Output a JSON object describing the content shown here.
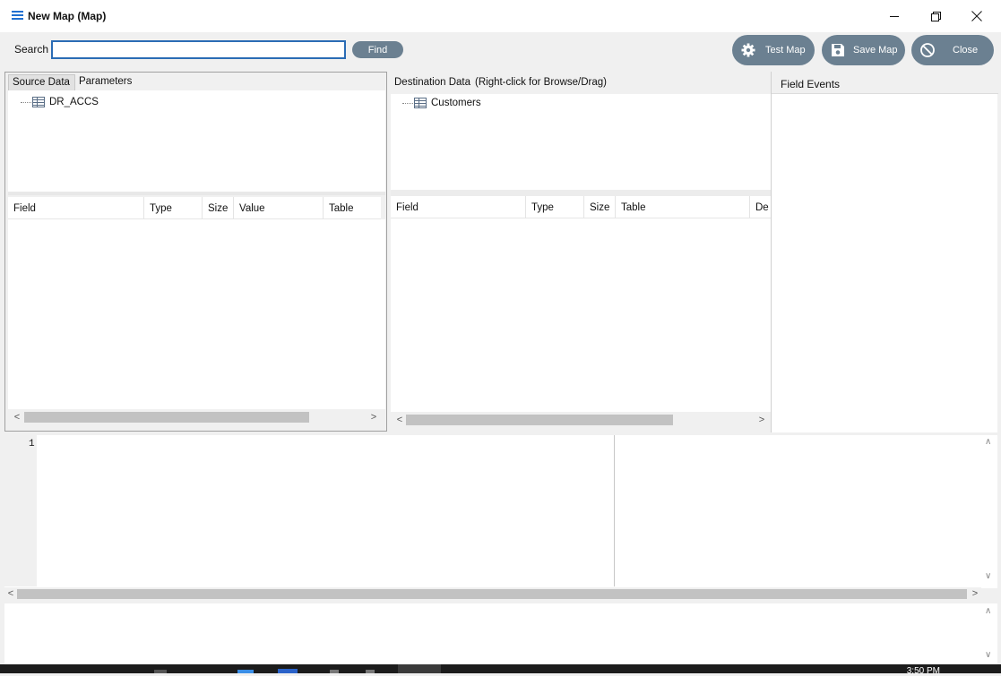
{
  "window": {
    "title": "New Map (Map)",
    "minimize_icon": "minimize-icon",
    "restore_icon": "restore-icon",
    "close_icon": "close-icon"
  },
  "toolbar": {
    "search_label": "Search",
    "search_value": "",
    "find_label": "Find",
    "test_map_label": "Test Map",
    "save_map_label": "Save Map",
    "close_label": "Close",
    "button_color": "#6b8091"
  },
  "source": {
    "tabs": [
      {
        "label": "Source Data",
        "active": true
      },
      {
        "label": "Parameters",
        "active": false
      }
    ],
    "tree": [
      {
        "label": "DR_ACCS",
        "icon": "table-icon"
      }
    ],
    "columns": [
      "Field",
      "Type",
      "Size",
      "Value",
      "Table"
    ]
  },
  "destination": {
    "header": "Destination Data",
    "hint": "(Right-click for Browse/Drag)",
    "tree": [
      {
        "label": "Customers",
        "icon": "table-icon"
      }
    ],
    "columns": [
      "Field",
      "Type",
      "Size",
      "Table",
      "De"
    ]
  },
  "events": {
    "header": "Field Events"
  },
  "editor": {
    "line_numbers": [
      "1"
    ]
  },
  "taskbar": {
    "time": "3:50 PM"
  }
}
